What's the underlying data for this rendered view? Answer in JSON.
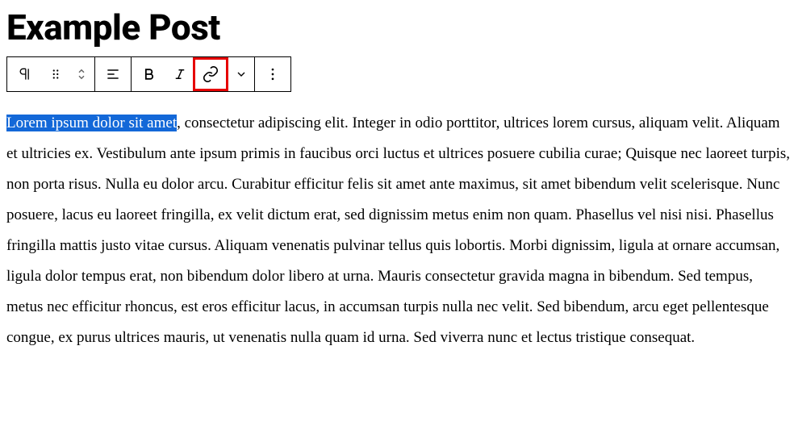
{
  "title": "Example Post",
  "toolbar": {
    "block_type_label": "Change block type or style",
    "drag_label": "Drag",
    "move_label": "Move up/down",
    "align_label": "Align",
    "bold_label": "Bold",
    "italic_label": "Italic",
    "link_label": "Link",
    "more_formatting_label": "More rich text controls",
    "options_label": "Options"
  },
  "content": {
    "selected": "Lorem ipsum dolor sit amet",
    "rest": ", consectetur adipiscing elit. Integer in odio porttitor, ultrices lorem cursus, aliquam velit. Aliquam et ultricies ex. Vestibulum ante ipsum primis in faucibus orci luctus et ultrices posuere cubilia curae; Quisque nec laoreet turpis, non porta risus. Nulla eu dolor arcu. Curabitur efficitur felis sit amet ante maximus, sit amet bibendum velit scelerisque. Nunc posuere, lacus eu laoreet fringilla, ex velit dictum erat, sed dignissim metus enim non quam. Phasellus vel nisi nisi. Phasellus fringilla mattis justo vitae cursus. Aliquam venenatis pulvinar tellus quis lobortis. Morbi dignissim, ligula at ornare accumsan, ligula dolor tempus erat, non bibendum dolor libero at urna. Mauris consectetur gravida magna in bibendum. Sed tempus, metus nec efficitur rhoncus, est eros efficitur lacus, in accumsan turpis nulla nec velit. Sed bibendum, arcu eget pellentesque congue, ex purus ultrices mauris, ut venenatis nulla quam id urna. Sed viverra nunc et lectus tristique consequat."
  }
}
